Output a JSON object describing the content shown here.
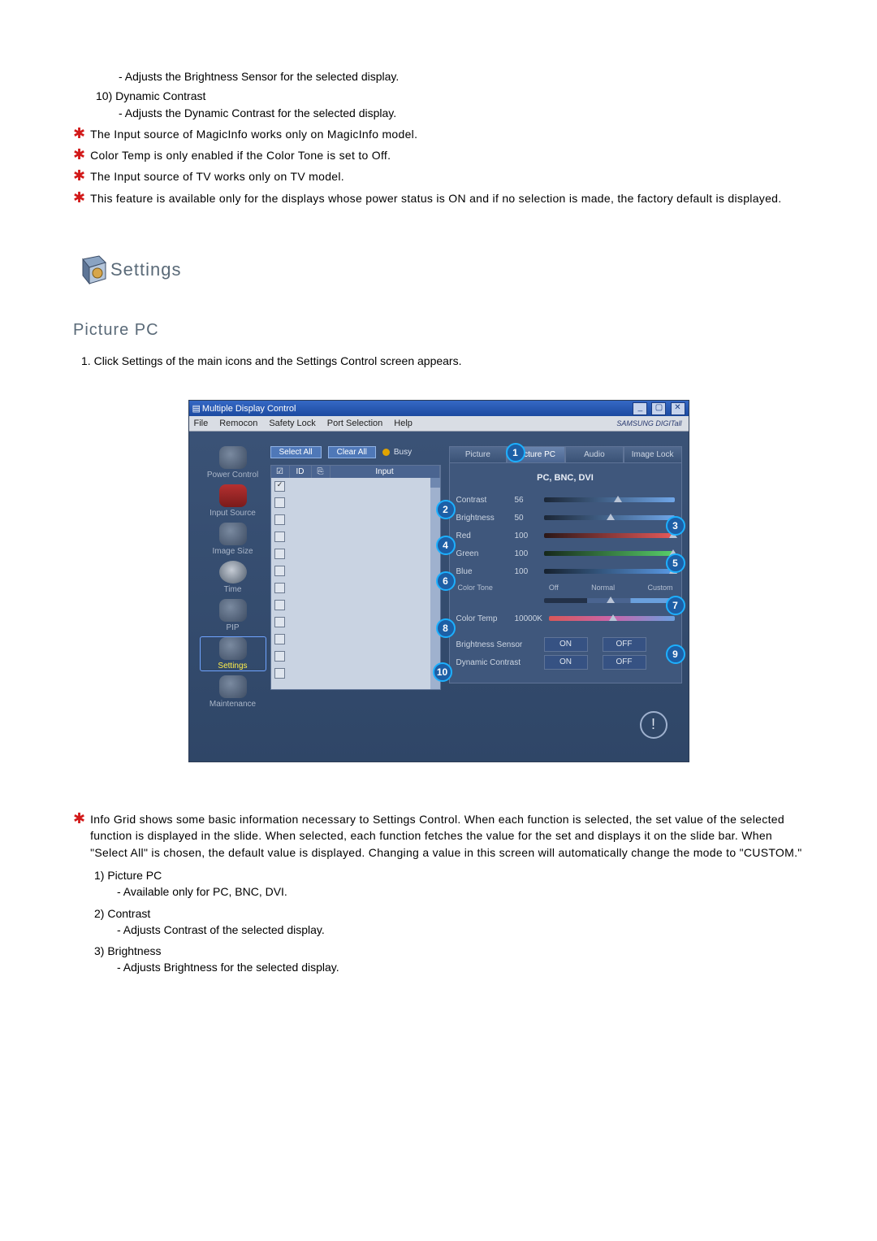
{
  "top": {
    "adjust_brightness_sensor": "- Adjusts the Brightness Sensor for the selected display.",
    "item10_num": "10)",
    "item10_title": "Dynamic Contrast",
    "item10_sub": "- Adjusts the Dynamic Contrast for the selected display.",
    "star1": "The Input source of MagicInfo works only on MagicInfo model.",
    "star2": "Color Temp is only enabled if the Color Tone is set to Off.",
    "star3": "The Input source of TV works only on TV model.",
    "star4": "This feature is available only for the displays whose power status is ON and if no selection is made, the factory default is displayed."
  },
  "section": {
    "settings": "Settings",
    "picture_pc": "Picture PC",
    "step1_num": "1.",
    "step1": "Click Settings of the main icons and the Settings Control screen appears."
  },
  "win": {
    "title": "Multiple Display Control",
    "menu": {
      "file": "File",
      "remocon": "Remocon",
      "safety": "Safety Lock",
      "port": "Port Selection",
      "help": "Help"
    },
    "brand": "SAMSUNG DIGITall",
    "sidebar": {
      "power": "Power Control",
      "input": "Input Source",
      "size": "Image Size",
      "time": "Time",
      "pip": "PIP",
      "settings": "Settings",
      "maint": "Maintenance"
    },
    "buttons": {
      "select_all": "Select All",
      "clear_all": "Clear All",
      "busy": "Busy"
    },
    "grid": {
      "h1": "☑",
      "h2": "ID",
      "h3": "⎘",
      "h4": "Input"
    },
    "tabs": {
      "picture": "Picture",
      "picture_pc": "Picture PC",
      "audio": "Audio",
      "image_lock": "Image Lock"
    },
    "panel": {
      "header": "PC, BNC, DVI",
      "contrast": "Contrast",
      "contrast_v": "56",
      "brightness": "Brightness",
      "brightness_v": "50",
      "red": "Red",
      "red_v": "100",
      "green": "Green",
      "green_v": "100",
      "blue": "Blue",
      "blue_v": "100",
      "color_tone": "Color Tone",
      "tone_off": "Off",
      "tone_normal": "Normal",
      "tone_custom": "Custom",
      "color_temp": "Color Temp",
      "color_temp_v": "10000K",
      "bright_sensor": "Brightness Sensor",
      "dyn_contrast": "Dynamic Contrast",
      "on": "ON",
      "off": "OFF"
    },
    "callouts": {
      "c1": "1",
      "c2": "2",
      "c3": "3",
      "c4": "4",
      "c5": "5",
      "c6": "6",
      "c7": "7",
      "c8": "8",
      "c9": "9",
      "c10": "10"
    }
  },
  "lower": {
    "star_info": "Info Grid shows some basic information necessary to Settings Control. When each function is selected, the set value of the selected function is displayed in the slide. When selected, each function fetches the value for the set and displays it on the slide bar. When \"Select All\" is chosen, the default value is displayed. Changing a value in this screen will automatically change the mode to \"CUSTOM.\"",
    "i1_num": "1)",
    "i1_title": "Picture PC",
    "i1_sub": "- Available only for PC, BNC, DVI.",
    "i2_num": "2)",
    "i2_title": "Contrast",
    "i2_sub": "- Adjusts Contrast of the selected display.",
    "i3_num": "3)",
    "i3_title": "Brightness",
    "i3_sub": "- Adjusts Brightness for the selected display."
  }
}
